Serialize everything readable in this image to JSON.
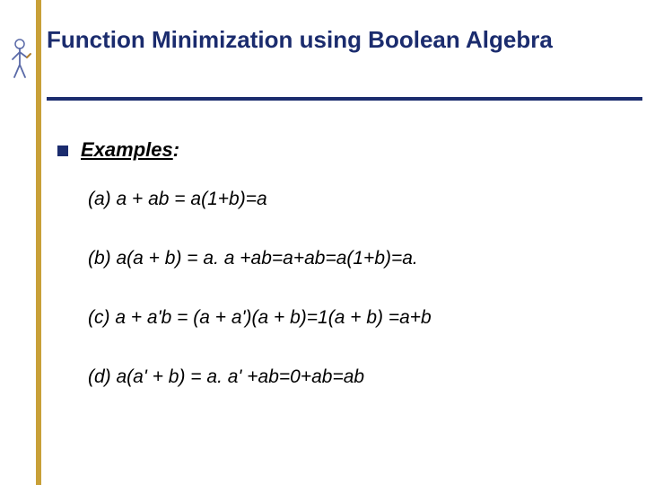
{
  "title": "Function Minimization using  Boolean Algebra",
  "examples_label_underlined": "Examples",
  "examples_label_rest": ":",
  "examples": {
    "a": "(a) a + ab = a(1+b)=a",
    "b": "(b) a(a + b) = a. a +ab=a+ab=a(1+b)=a.",
    "c": "(c) a + a'b = (a + a')(a + b)=1(a + b) =a+b",
    "d": "(d) a(a' + b) = a. a' +ab=0+ab=ab"
  }
}
